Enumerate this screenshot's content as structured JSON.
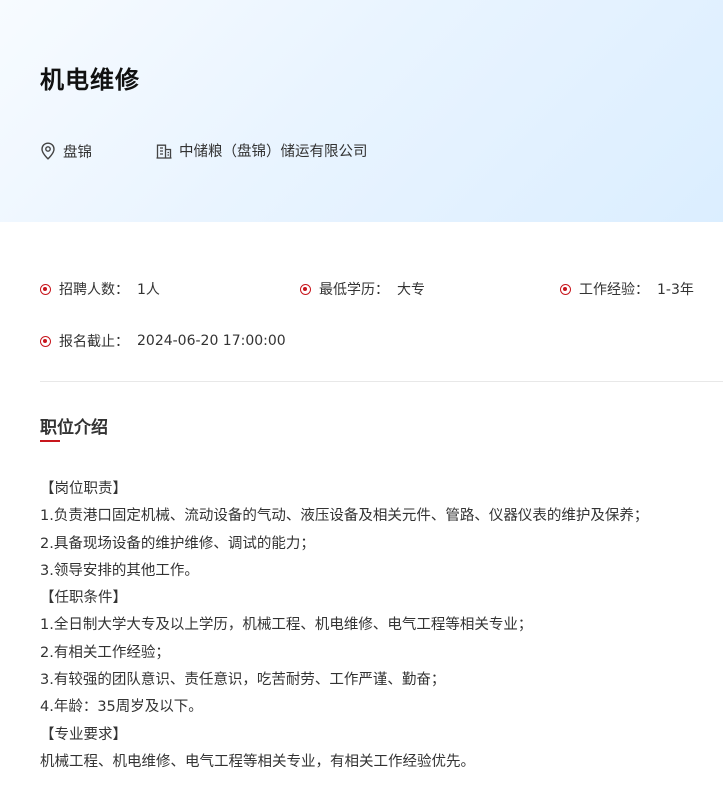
{
  "job": {
    "title": "机电维修",
    "location": "盘锦",
    "company": "中储粮（盘锦）储运有限公司"
  },
  "details": {
    "headcount": {
      "label": "招聘人数：",
      "value": "1人"
    },
    "education": {
      "label": "最低学历：",
      "value": "大专"
    },
    "experience": {
      "label": "工作经验：",
      "value": "1-3年"
    },
    "deadline": {
      "label": "报名截止：",
      "value": "2024-06-20 17:00:00"
    }
  },
  "section": {
    "title": "职位介绍"
  },
  "description": {
    "lines": [
      "【岗位职责】",
      "1.负责港口固定机械、流动设备的气动、液压设备及相关元件、管路、仪器仪表的维护及保养；",
      "2.具备现场设备的维护维修、调试的能力；",
      "3.领导安排的其他工作。",
      "【任职条件】",
      "1.全日制大学大专及以上学历，机械工程、机电维修、电气工程等相关专业；",
      "2.有相关工作经验；",
      "3.有较强的团队意识、责任意识，吃苦耐劳、工作严谨、勤奋；",
      "4.年龄：35周岁及以下。",
      "【专业要求】",
      "机械工程、机电维修、电气工程等相关专业，有相关工作经验优先。"
    ]
  },
  "icons": {
    "location": "location-pin-icon",
    "company": "building-icon",
    "bullet": "bullet-dot-icon"
  },
  "colors": {
    "accent": "#c8161d",
    "hero_bg": "#e6f3ff",
    "divider": "#e8e8e8"
  }
}
